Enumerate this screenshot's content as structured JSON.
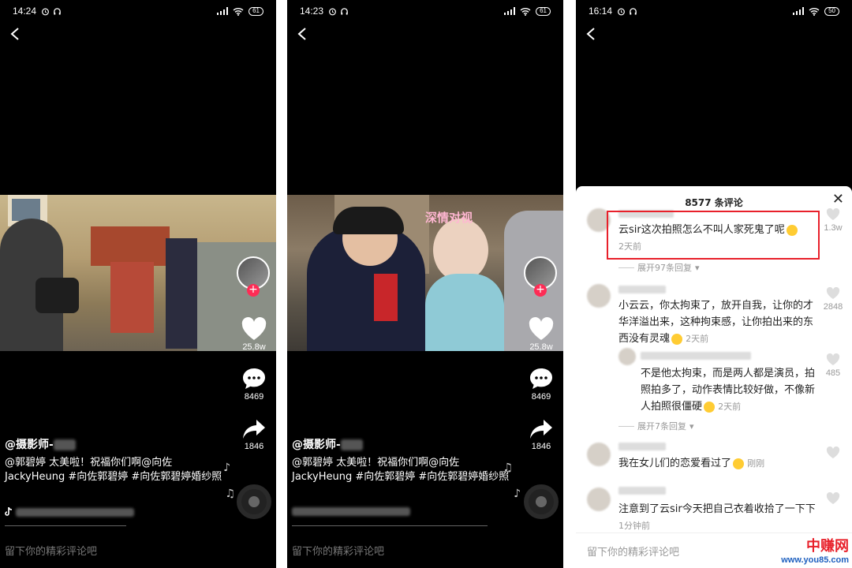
{
  "screens": [
    {
      "status": {
        "time": "14:24",
        "battery": "61"
      },
      "caption": {
        "author": "@摄影师-",
        "text": "@郭碧婷 太美啦！祝福你们啊@向佐 JackyHeung #向佐郭碧婷 #向佐郭碧婷婚纱照"
      },
      "actions": {
        "likes": "25.8w",
        "comments": "8469",
        "shares": "1846"
      },
      "comment_placeholder": "留下你的精彩评论吧"
    },
    {
      "status": {
        "time": "14:23",
        "battery": "61"
      },
      "video_overlay_text": "深情对视",
      "caption": {
        "author": "@摄影师-",
        "text": "@郭碧婷 太美啦！祝福你们啊@向佐 JackyHeung #向佐郭碧婷 #向佐郭碧婷婚纱照"
      },
      "actions": {
        "likes": "25.8w",
        "comments": "8469",
        "shares": "1846"
      },
      "comment_placeholder": "留下你的精彩评论吧"
    },
    {
      "status": {
        "time": "16:14",
        "battery": "50"
      },
      "panel": {
        "title": "8577 条评论",
        "close_label": "✕",
        "comments": [
          {
            "text": "云sir这次拍照怎么不叫人家死鬼了呢",
            "time": "2天前",
            "likes": "1.3w",
            "expand": "展开97条回复"
          },
          {
            "text": "小云云，你太拘束了，放开自我，让你的才华洋溢出来，这种拘束感，让你拍出来的东西没有灵魂",
            "time": "2天前",
            "likes": "2848"
          },
          {
            "text": "不是他太拘束，而是两人都是演员，拍照拍多了，动作表情比较好做，不像新人拍照很僵硬",
            "time": "2天前",
            "likes": "485",
            "expand": "展开7条回复"
          },
          {
            "text": "我在女儿们的恋爱看过了",
            "time": "刚刚"
          },
          {
            "text": "注意到了云sir今天把自己衣着收拾了一下下",
            "time": "1分钟前"
          }
        ],
        "input_placeholder": "留下你的精彩评论吧"
      }
    }
  ],
  "watermark": {
    "brand": "中赚网",
    "url": "www.you85.com"
  },
  "colors": {
    "accent_red": "#fe2c55",
    "highlight_box": "#e8202a",
    "watermark_blue": "#1d5fbf"
  }
}
